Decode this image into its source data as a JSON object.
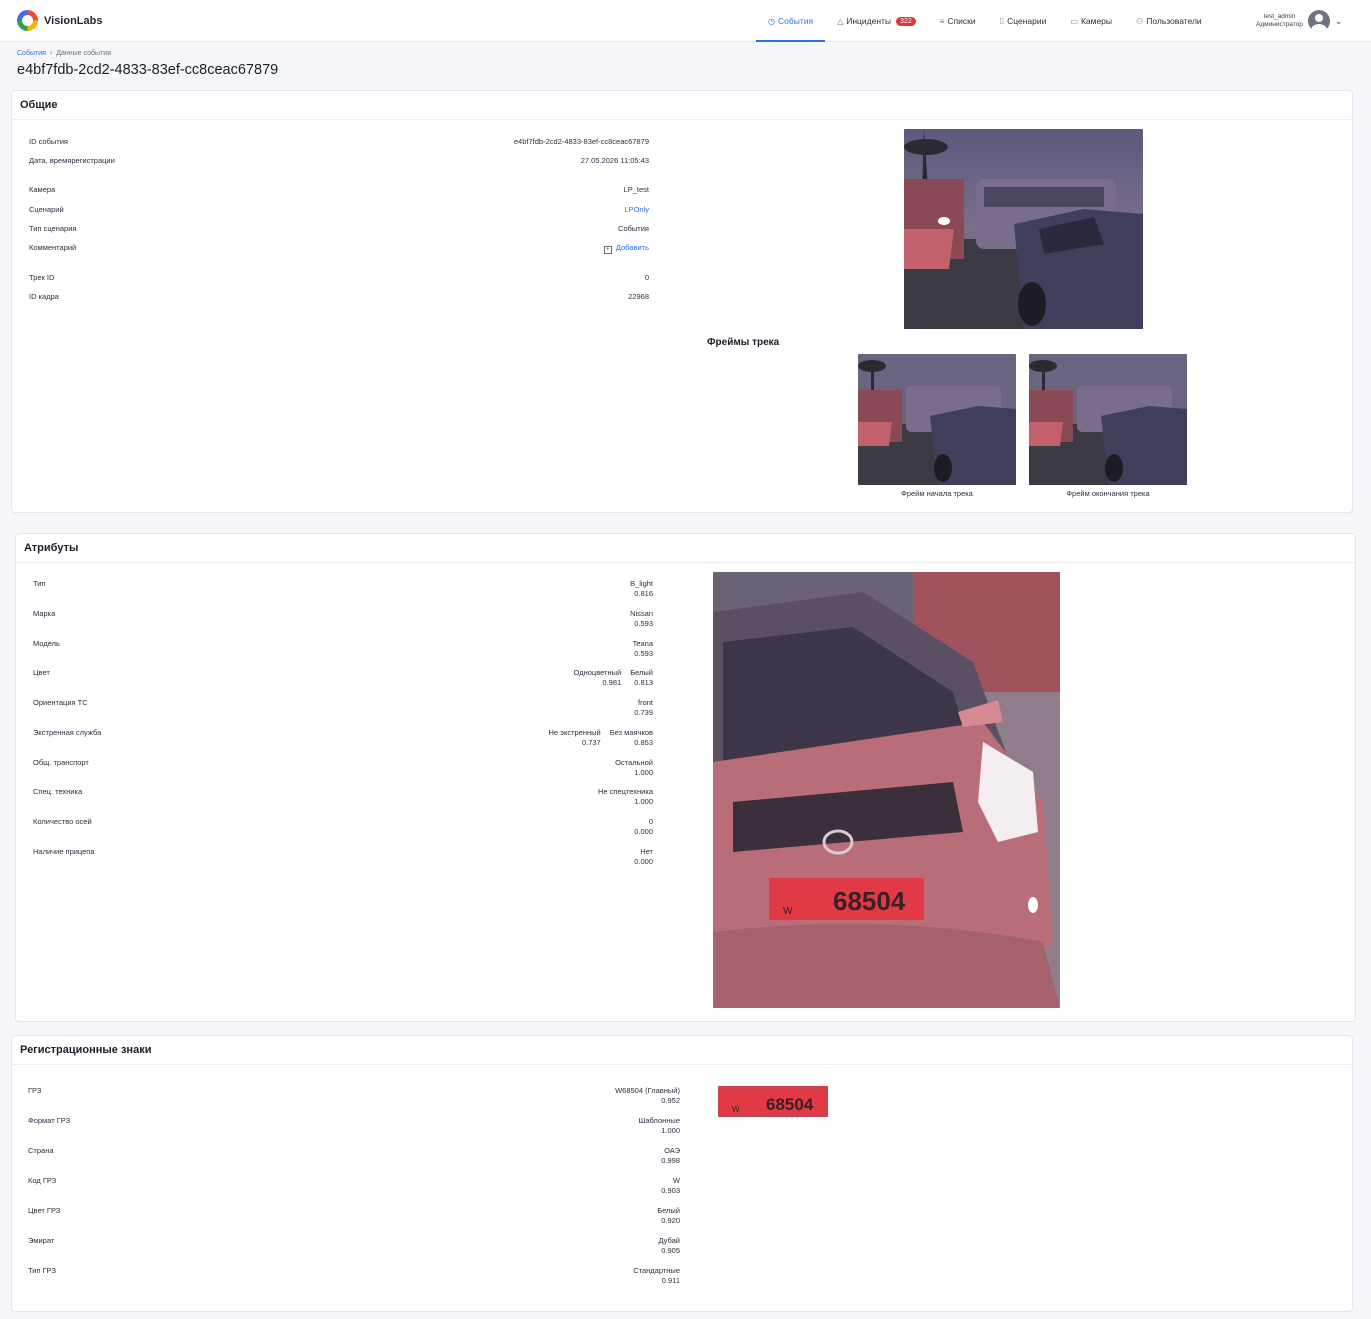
{
  "app": {
    "name": "VisionLabs"
  },
  "nav": {
    "items": [
      {
        "label": "События",
        "icon": "clock-icon",
        "active": true
      },
      {
        "label": "Инциденты",
        "icon": "warning-icon",
        "badge": "322"
      },
      {
        "label": "Списки",
        "icon": "list-icon"
      },
      {
        "label": "Сценарии",
        "icon": "scenario-icon"
      },
      {
        "label": "Камеры",
        "icon": "camera-icon"
      },
      {
        "label": "Пользователи",
        "icon": "users-icon"
      }
    ]
  },
  "user": {
    "login": "test_admin",
    "role": "Администратор"
  },
  "breadcrumb": {
    "root": "События",
    "sep": "›",
    "current": "Данные события"
  },
  "page": {
    "title": "e4bf7fdb-2cd2-4833-83ef-cc8ceac67879"
  },
  "general": {
    "title": "Общие",
    "rows": [
      {
        "label": "ID события",
        "value": "e4bf7fdb-2cd2-4833-83ef-cc8ceac67879"
      },
      {
        "label": "Дата, время",
        "label2": "регистрации",
        "value": "27.05.2026 11:05:43"
      },
      {
        "label": "Камера",
        "value": "LP_test"
      },
      {
        "label": "Сценарий",
        "value": "LPOnly"
      },
      {
        "label": "Тип сценария",
        "value": "События"
      },
      {
        "label": "Комментарий",
        "value": "Добавить"
      },
      {
        "label": "Трек ID",
        "value": "0"
      },
      {
        "label": "ID кадра",
        "value": "22968"
      }
    ],
    "track_frames_title": "Фреймы трека",
    "frame_start_caption": "Фрейм начала трека",
    "frame_end_caption": "Фрейм окончания трека"
  },
  "attributes": {
    "title": "Атрибуты",
    "rows": [
      {
        "label": "Тип",
        "value": "B_light",
        "score": "0.816"
      },
      {
        "label": "Марка",
        "value": "Nissan",
        "score": "0.593"
      },
      {
        "label": "Модель",
        "value": "Teana",
        "score": "0.593"
      },
      {
        "label": "Цвет",
        "value": "Одноцветный",
        "score": "0.981",
        "value2": "Белый",
        "score2": "0.813"
      },
      {
        "label": "Ориентация ТС",
        "value": "front",
        "score": "0.739"
      },
      {
        "label": "Экстренная служба",
        "value": "Не экстренный",
        "score": "0.737",
        "value2": "Без маячков",
        "score2": "0.853"
      },
      {
        "label": "Общ. транспорт",
        "value": "Остальной",
        "score": "1.000"
      },
      {
        "label": "Спец. техника",
        "value": "Не спецтехника",
        "score": "1.000"
      },
      {
        "label": "Количество осей",
        "value": "0",
        "score": "0.000"
      },
      {
        "label": "Наличие прицепа",
        "value": "Нет",
        "score": "0.000"
      }
    ],
    "plate_text": "68504",
    "plate_code": "W"
  },
  "plates": {
    "title": "Регистрационные знаки",
    "rows": [
      {
        "label": "ГРЗ",
        "value": "W68504 (Главный)",
        "score": "0.952"
      },
      {
        "label": "Формат ГРЗ",
        "value": "Шаблонные",
        "score": "1.000"
      },
      {
        "label": "Страна",
        "value": "ОАЭ",
        "score": "0.998"
      },
      {
        "label": "Код ГРЗ",
        "value": "W",
        "score": "0.903"
      },
      {
        "label": "Цвет ГРЗ",
        "value": "Белый",
        "score": "0.920"
      },
      {
        "label": "Эмират",
        "value": "Дубай",
        "score": "0.905"
      },
      {
        "label": "Тип ГРЗ",
        "value": "Стандартные",
        "score": "0.911"
      }
    ],
    "crop_text": "68504",
    "crop_code": "W"
  },
  "colors": {
    "accent": "#2f6fe4",
    "badge": "#e0353c"
  }
}
